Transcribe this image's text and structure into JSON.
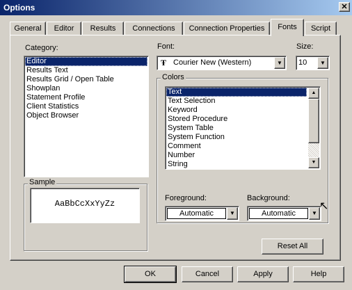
{
  "window": {
    "title": "Options",
    "close_glyph": "✕"
  },
  "tabs": [
    {
      "label": "General"
    },
    {
      "label": "Editor"
    },
    {
      "label": "Results"
    },
    {
      "label": "Connections"
    },
    {
      "label": "Connection Properties"
    },
    {
      "label": "Fonts"
    },
    {
      "label": "Script"
    }
  ],
  "category": {
    "label": "Category:",
    "items": [
      "Editor",
      "Results Text",
      "Results Grid / Open Table",
      "Showplan",
      "Statement Profile",
      "Client Statistics",
      "Object Browser"
    ],
    "selected": "Editor"
  },
  "font": {
    "label": "Font:",
    "value": "Courier New (Western)",
    "icon_glyph": "Ŧ"
  },
  "size": {
    "label": "Size:",
    "value": "10"
  },
  "colors": {
    "label": "Colors",
    "items": [
      "Text",
      "Text Selection",
      "Keyword",
      "Stored Procedure",
      "System Table",
      "System Function",
      "Comment",
      "Number",
      "String"
    ],
    "selected": "Text",
    "foreground": {
      "label": "Foreground:",
      "value": "Automatic"
    },
    "background": {
      "label": "Background:",
      "value": "Automatic"
    }
  },
  "sample": {
    "label": "Sample",
    "text": "AaBbCcXxYyZz"
  },
  "reset_all": {
    "label": "Reset All"
  },
  "footer": {
    "ok": "OK",
    "cancel": "Cancel",
    "apply": "Apply",
    "help": "Help"
  },
  "glyphs": {
    "arrow_down": "▼",
    "arrow_up": "▲",
    "cursor": "↖"
  }
}
